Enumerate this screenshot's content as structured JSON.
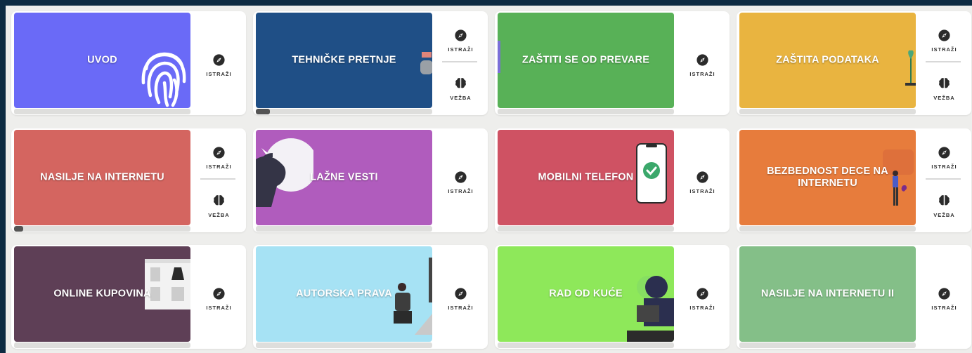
{
  "colors": {
    "page_background": "#0d2b42",
    "grid_background": "#eeeeec",
    "card_background": "#ffffff",
    "progress_track": "#dededc",
    "progress_fill": "#555555"
  },
  "labels": {
    "explore": "ISTRAŽI",
    "practice": "VEŽBA"
  },
  "icons": {
    "explore": "compass-icon",
    "practice": "brain-icon"
  },
  "modules": [
    {
      "title": "UVOD",
      "color": "#6a6af7",
      "illustration": "fingerprint-icon",
      "has_practice": false,
      "progress": 0
    },
    {
      "title": "TEHNIČKE PRETNJE",
      "color": "#1f4f86",
      "illustration": "person-at-desk",
      "has_practice": true,
      "progress": 0.08
    },
    {
      "title": "ZAŠTITI SE OD PREVARE",
      "color": "#58b157",
      "illustration": "laptop-edge",
      "has_practice": false,
      "progress": 0
    },
    {
      "title": "ZAŠTITA PODATAKA",
      "color": "#e9b440",
      "illustration": "plant",
      "has_practice": true,
      "progress": 0
    },
    {
      "title": "NASILJE NA INTERNETU",
      "color": "#d46560",
      "illustration": "none",
      "has_practice": true,
      "progress": 0.05
    },
    {
      "title": "LAŽNE VESTI",
      "color": "#b05cbd",
      "illustration": "unicorn",
      "has_practice": false,
      "progress": 0
    },
    {
      "title": "MOBILNI TELEFON",
      "color": "#cf5263",
      "illustration": "phone-checkmark",
      "has_practice": false,
      "progress": 0
    },
    {
      "title": "BEZBEDNOST DECE NA INTERNETU",
      "color": "#e77c3c",
      "illustration": "child-figure",
      "has_practice": true,
      "progress": 0
    },
    {
      "title": "ONLINE KUPOVINA",
      "color": "#5e3f56",
      "illustration": "shop-window",
      "has_practice": false,
      "progress": 0
    },
    {
      "title": "AUTORSKA PRAVA",
      "color": "#a6e2f4",
      "illustration": "person-with-laptop",
      "has_practice": false,
      "progress": 0
    },
    {
      "title": "RAD OD KUĆE",
      "color": "#8ee85a",
      "illustration": "person-at-computer",
      "has_practice": false,
      "progress": 0
    },
    {
      "title": "NASILJE NA INTERNETU II",
      "color": "#84bf88",
      "illustration": "none",
      "has_practice": false,
      "progress": 0
    }
  ]
}
